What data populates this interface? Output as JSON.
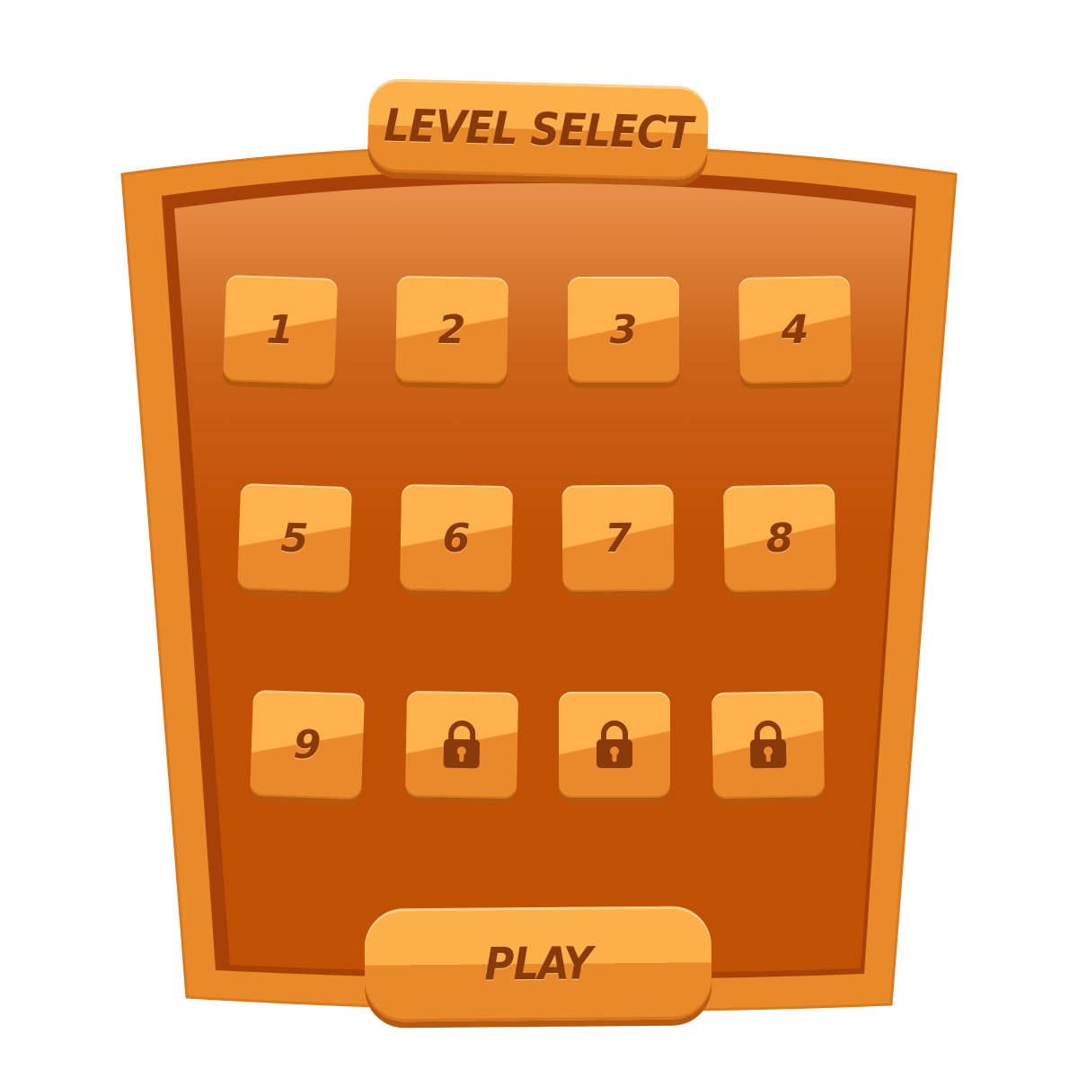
{
  "header": {
    "title": "LEVEL SELECT"
  },
  "levels": [
    {
      "label": "1",
      "locked": false
    },
    {
      "label": "2",
      "locked": false
    },
    {
      "label": "3",
      "locked": false
    },
    {
      "label": "4",
      "locked": false
    },
    {
      "label": "5",
      "locked": false
    },
    {
      "label": "6",
      "locked": false
    },
    {
      "label": "7",
      "locked": false
    },
    {
      "label": "8",
      "locked": false
    },
    {
      "label": "9",
      "locked": false
    },
    {
      "label": "",
      "locked": true,
      "icon": "lock-icon"
    },
    {
      "label": "",
      "locked": true,
      "icon": "lock-icon"
    },
    {
      "label": "",
      "locked": true,
      "icon": "lock-icon"
    }
  ],
  "footer": {
    "play_label": "PLAY"
  },
  "colors": {
    "frame": "#e8892a",
    "panel": "#c15004",
    "tile_light": "#fdb24b",
    "tile_dark": "#e9892b",
    "text": "#8a3a08"
  }
}
